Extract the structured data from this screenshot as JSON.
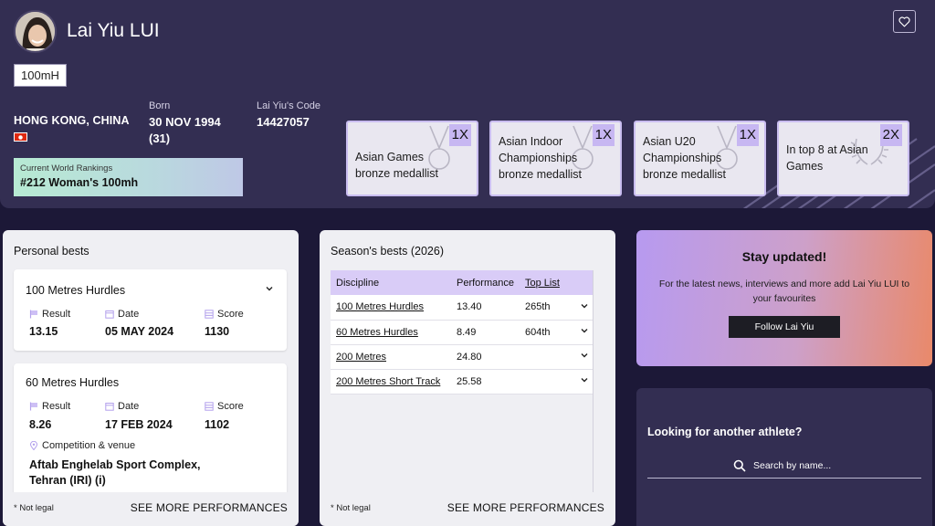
{
  "athlete": {
    "name": "Lai Yiu LUI",
    "discipline": "100mH",
    "country": "HONG KONG, CHINA",
    "born_label": "Born",
    "born_value": "30 NOV 1994",
    "age": "(31)",
    "code_label": "Lai Yiu's Code",
    "code_value": "14427057",
    "ranking_label": "Current World Rankings",
    "ranking_value": "#212 Woman's 100mh"
  },
  "honours": [
    {
      "label": "Asian Games bronze medallist",
      "count": "1X",
      "icon": "medal-icon"
    },
    {
      "label": "Asian Indoor Championships bronze medallist",
      "count": "1X",
      "icon": "medal-icon"
    },
    {
      "label": "Asian U20 Championships bronze medallist",
      "count": "1X",
      "icon": "medal-icon"
    },
    {
      "label": "In top 8 at Asian Games",
      "count": "2X",
      "icon": "laurel-icon"
    }
  ],
  "personal_bests": {
    "title": "Personal bests",
    "items": [
      {
        "event": "100 Metres Hurdles",
        "result_label": "Result",
        "result": "13.15",
        "date_label": "Date",
        "date": "05 MAY 2024",
        "score_label": "Score",
        "score": "1130"
      },
      {
        "event": "60 Metres Hurdles",
        "result_label": "Result",
        "result": "8.26",
        "date_label": "Date",
        "date": "17 FEB 2024",
        "score_label": "Score",
        "score": "1102",
        "venue_label": "Competition & venue",
        "venue": "Aftab Enghelab Sport Complex, Tehran (IRI) (i)"
      }
    ],
    "not_legal": "* Not legal",
    "see_more": "SEE MORE PERFORMANCES"
  },
  "season_bests": {
    "title": "Season's bests (2026)",
    "columns": [
      "Discipline",
      "Performance",
      "Top List"
    ],
    "rows": [
      {
        "discipline": "100 Metres Hurdles",
        "performance": "13.40",
        "top_list": "265th"
      },
      {
        "discipline": "60 Metres Hurdles",
        "performance": "8.49",
        "top_list": "604th"
      },
      {
        "discipline": "200 Metres",
        "performance": "24.80",
        "top_list": ""
      },
      {
        "discipline": "200 Metres Short Track",
        "performance": "25.58",
        "top_list": ""
      }
    ],
    "not_legal": "* Not legal",
    "see_more": "SEE MORE PERFORMANCES"
  },
  "promo": {
    "title": "Stay updated!",
    "description": "For the latest news, interviews and more add Lai Yiu LUI to your favourites",
    "button": "Follow Lai Yiu"
  },
  "search": {
    "title": "Looking for another athlete?",
    "placeholder": "Search by name..."
  },
  "colors": {
    "page_bg": "#1c1837",
    "header_bg": "#332e52",
    "accent_lavender": "#c7b7f2",
    "promo_start": "#b79af0",
    "promo_end": "#e9896a"
  }
}
